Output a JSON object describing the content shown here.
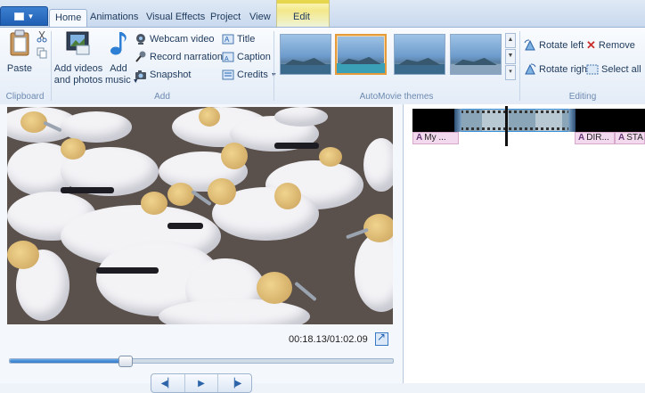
{
  "tabs": [
    {
      "label": "Home"
    },
    {
      "label": "Animations"
    },
    {
      "label": "Visual Effects"
    },
    {
      "label": "Project"
    },
    {
      "label": "View"
    },
    {
      "label": "Edit"
    }
  ],
  "ribbon": {
    "clipboard": {
      "paste": "Paste",
      "group": "Clipboard"
    },
    "add": {
      "add_videos_line1": "Add videos",
      "add_videos_line2": "and photos",
      "add_music_line1": "Add",
      "add_music_line2": "music",
      "webcam": "Webcam video",
      "narration": "Record narration",
      "snapshot": "Snapshot",
      "title": "Title",
      "caption": "Caption",
      "credits": "Credits",
      "group": "Add"
    },
    "automovie": {
      "group": "AutoMovie themes"
    },
    "editing": {
      "rotate_left": "Rotate left",
      "rotate_right": "Rotate right",
      "remove": "Remove",
      "select_all": "Select all",
      "group": "Editing"
    }
  },
  "preview": {
    "timecode": "00:18.13/01:02.09",
    "progress": 0.3
  },
  "storyboard": {
    "captions": [
      {
        "icon": "A",
        "text": "My ..."
      },
      {
        "icon": "A",
        "text": "DIR..."
      },
      {
        "icon": "A",
        "text": "STA..."
      }
    ]
  },
  "colors": {
    "accent": "#1f5fb4",
    "selection": "#e59a3c",
    "caption_chip": "#f3d9ee"
  }
}
